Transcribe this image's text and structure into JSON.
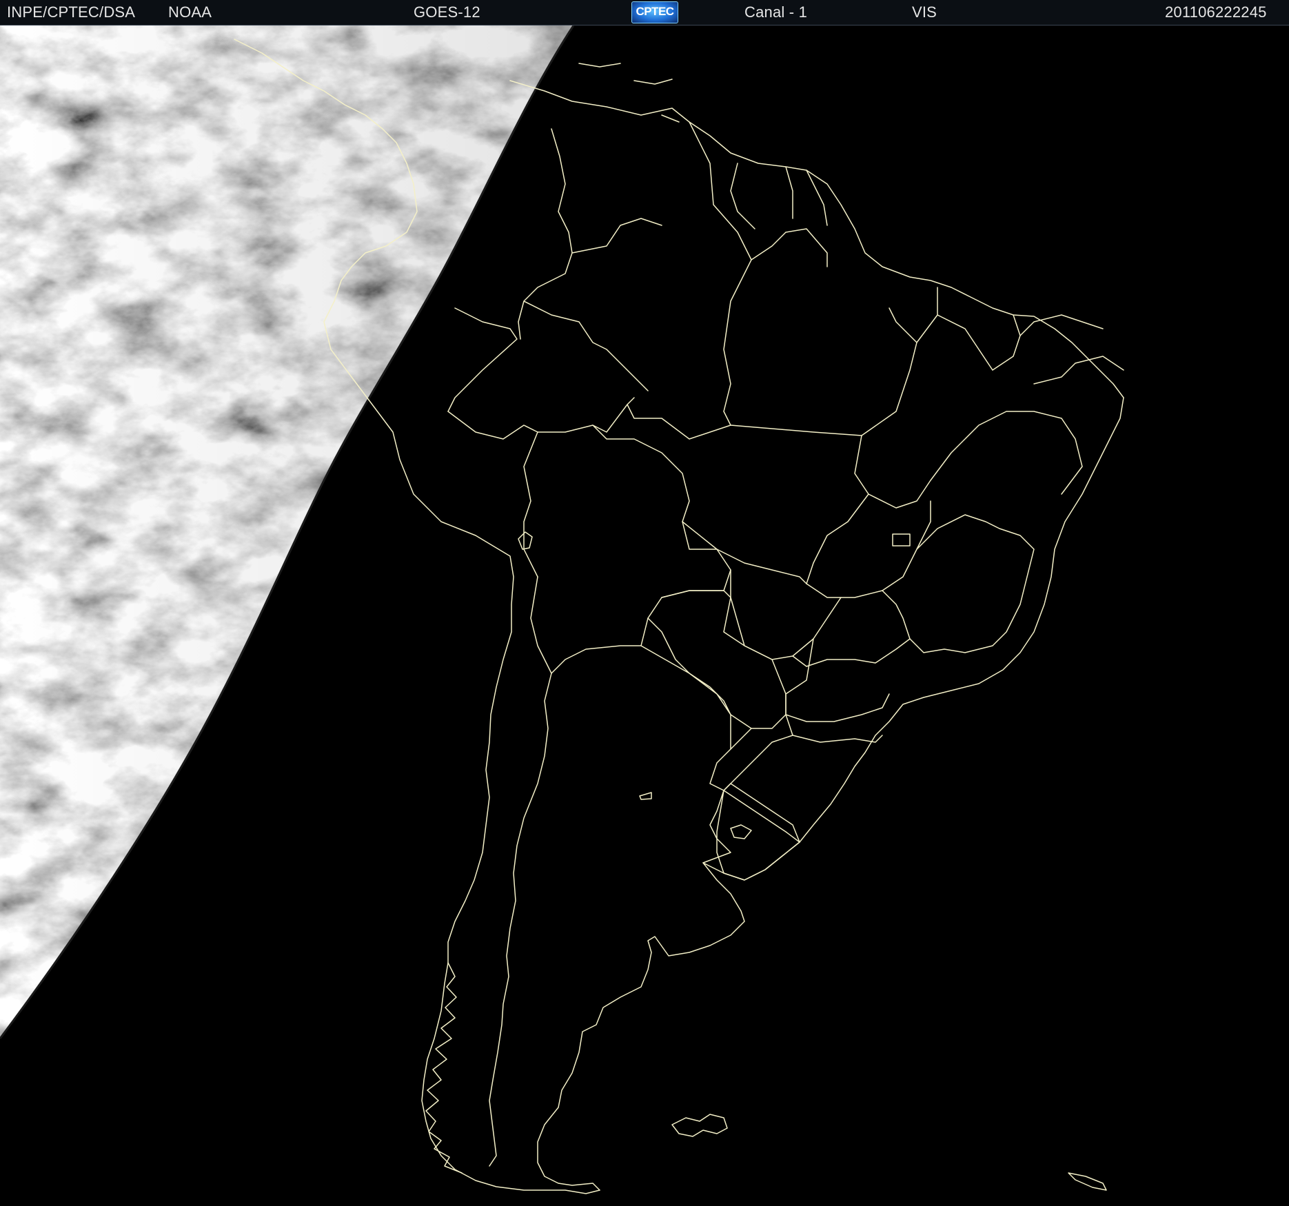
{
  "header": {
    "agency": "INPE/CPTEC/DSA",
    "source": "NOAA",
    "satellite": "GOES-12",
    "logo_text": "CPTEC",
    "channel": "Canal - 1",
    "band": "VIS",
    "timestamp": "201106222245"
  },
  "colors": {
    "background": "#000000",
    "header_bg": "#0b0f14",
    "header_text": "#e6e6e6",
    "boundary_line": "#f4f0c8",
    "daylight_cloud": "#8a8a8a"
  },
  "map": {
    "region": "South America",
    "daylight_side": "west"
  }
}
